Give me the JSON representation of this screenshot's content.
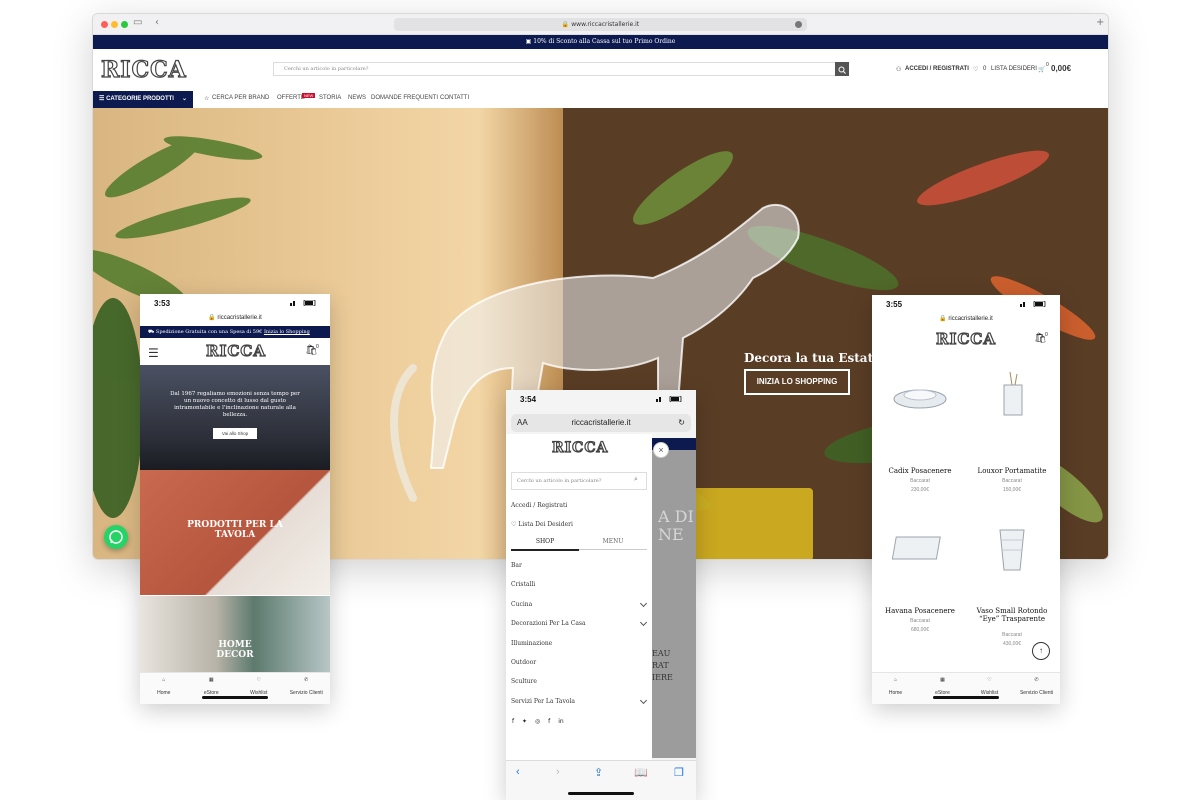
{
  "desktop": {
    "url": "www.riccacristallerie.it",
    "promo_text": "10% di Sconto alla Cassa sul tuo Primo Ordine",
    "logo": "RICCA",
    "search_placeholder": "Cerchi un articolo in particolare?",
    "account_label": "ACCEDI / REGISTRATI",
    "wishlist_count": "0",
    "wishlist_label": "LISTA DESIDERI",
    "cart_count": "0",
    "cart_total": "0,00€",
    "categories_button": "CATEGORIE PRODOTTI",
    "nav": [
      "CERCA PER BRAND",
      "OFFERTE",
      "STORIA",
      "NEWS",
      "DOMANDE FREQUENTI",
      "CONTATTI"
    ],
    "offers_badge": "NEW",
    "hero_title": "Decora la tua Estate",
    "hero_cta": "INIZIA LO SHOPPING"
  },
  "phone_left": {
    "time": "3:53",
    "url": "riccacristallerie.it",
    "banner_text": "Spedizione Gratuita con una Spesa di 59€",
    "banner_link": "Inizia lo Shopping",
    "logo": "RICCA",
    "cart_count": "0",
    "hero_text": "Dal 1967 regaliamo emozioni senza tempo per un nuovo concetto di lusso dal gusto intramontabile e l'inclinazione naturale alla bellezza.",
    "hero_button": "Vai allo Shop",
    "section1": "PRODOTTI PER LA TAVOLA",
    "section2": "HOME DECOR",
    "tabs": [
      "Home",
      "eStore",
      "Wishlist",
      "Servizio Clienti"
    ]
  },
  "phone_middle": {
    "time": "3:54",
    "aa": "AA",
    "url": "riccacristallerie.it",
    "logo": "RICCA",
    "search_placeholder": "Cerchi un articolo in particolare?",
    "account": "Accedi / Registrati",
    "wishlist": "Lista Dei Desideri",
    "tab_shop": "SHOP",
    "tab_menu": "MENU",
    "categories": [
      "Bar",
      "Cristalli",
      "Cucina",
      "Decorazioni Per La Casa",
      "Illuminazione",
      "Outdoor",
      "Sculture",
      "Servizi Per La Tavola"
    ],
    "expandable": [
      false,
      false,
      true,
      true,
      false,
      false,
      false,
      true
    ],
    "bg_text_1": "A DI",
    "bg_text_2": "NE",
    "bg_text_3": "EAU",
    "bg_text_4": "RAT",
    "bg_text_5": "IERE"
  },
  "phone_right": {
    "time": "3:55",
    "url": "riccacristallerie.it",
    "logo": "RICCA",
    "cart_count": "0",
    "products": [
      {
        "name": "Cadix Posacenere",
        "brand": "Baccarat",
        "price": "230,00€"
      },
      {
        "name": "Louxor Portamatite",
        "brand": "Baccarat",
        "price": "150,00€"
      },
      {
        "name": "Havana Posacenere",
        "brand": "Baccarat",
        "price": "680,00€"
      },
      {
        "name": "Vaso Small Rotondo “Eye” Trasparente",
        "brand": "Baccarat",
        "price": "430,00€"
      }
    ],
    "tabs": [
      "Home",
      "eStore",
      "Wishlist",
      "Servizio Clienti"
    ]
  },
  "colors": {
    "navy": "#0d1a4f",
    "whatsapp": "#25d366",
    "offers_badge": "#c8102e"
  }
}
